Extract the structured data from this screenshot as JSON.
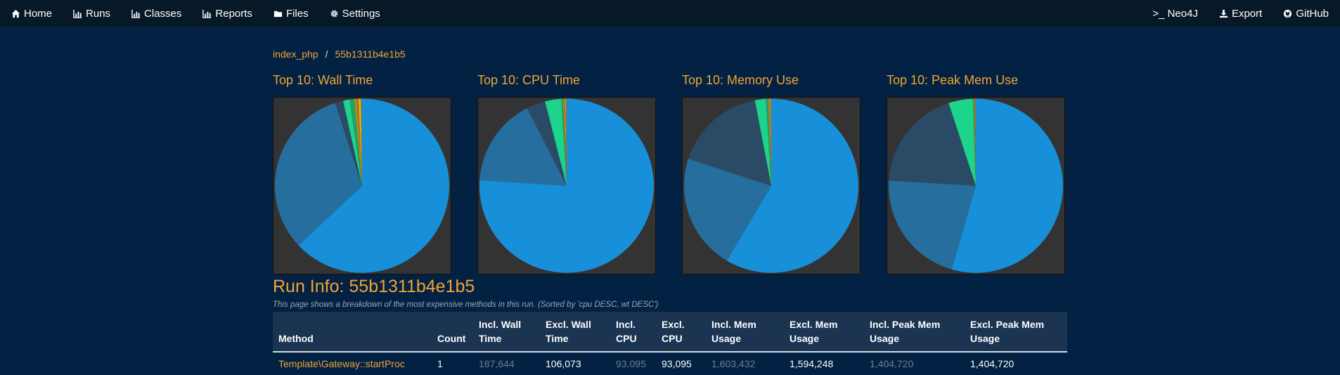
{
  "nav": {
    "left": [
      {
        "label": "Home",
        "icon": "home-icon"
      },
      {
        "label": "Runs",
        "icon": "bar-chart-icon"
      },
      {
        "label": "Classes",
        "icon": "bar-chart-icon"
      },
      {
        "label": "Reports",
        "icon": "bar-chart-icon"
      },
      {
        "label": "Files",
        "icon": "folder-icon"
      },
      {
        "label": "Settings",
        "icon": "gear-icon"
      }
    ],
    "right": [
      {
        "label": ">_ Neo4J",
        "icon": "terminal-icon"
      },
      {
        "label": "Export",
        "icon": "download-icon"
      },
      {
        "label": "GitHub",
        "icon": "github-icon"
      }
    ]
  },
  "breadcrumb": {
    "root": "index_php",
    "sep": "/",
    "current": "55b1311b4e1b5"
  },
  "charts": [
    {
      "title": "Top 10: Wall Time"
    },
    {
      "title": "Top 10: CPU Time"
    },
    {
      "title": "Top 10: Memory Use"
    },
    {
      "title": "Top 10: Peak Mem Use"
    }
  ],
  "chart_data": [
    {
      "type": "pie",
      "title": "Top 10: Wall Time",
      "values": [
        0.63,
        0.32,
        0.015,
        0.012,
        0.008,
        0.005,
        0.004,
        0.003,
        0.002,
        0.001
      ]
    },
    {
      "type": "pie",
      "title": "Top 10: CPU Time",
      "values": [
        0.76,
        0.165,
        0.035,
        0.03,
        0.003,
        0.002,
        0.002,
        0.001,
        0.001,
        0.001
      ]
    },
    {
      "type": "pie",
      "title": "Top 10: Memory Use",
      "values": [
        0.585,
        0.215,
        0.17,
        0.02,
        0.004,
        0.002,
        0.002,
        0.001,
        0.0005,
        0.0005
      ]
    },
    {
      "type": "pie",
      "title": "Top 10: Peak Mem Use",
      "values": [
        0.545,
        0.215,
        0.19,
        0.045,
        0.002,
        0.001,
        0.001,
        0.0005,
        0.0005,
        0.0005
      ]
    }
  ],
  "colors": {
    "slices": [
      "#1790d9",
      "#256e9d",
      "#2b4a66",
      "#1dd48c",
      "#21a06b",
      "#8a9a24",
      "#d0681e",
      "#e0c22a",
      "#4fbf3b",
      "#c84a2a"
    ],
    "accent": "#f0a533",
    "background": "#022143"
  },
  "run": {
    "title": "Run Info: 55b1311b4e1b5",
    "note": "This page shows a breakdown of the most expensive methods in this run. (Sorted by 'cpu DESC, wt DESC')"
  },
  "table": {
    "headers": [
      "Method",
      "Count",
      "Incl. Wall Time",
      "Excl. Wall Time",
      "Incl. CPU",
      "Excl. CPU",
      "Incl. Mem Usage",
      "Excl. Mem Usage",
      "Incl. Peak Mem Usage",
      "Excl. Peak Mem Usage"
    ],
    "rows": [
      [
        "Template\\Gateway::startProc",
        "1",
        "187,644",
        "106,073",
        "93,095",
        "93,095",
        "1,603,432",
        "1,594,248",
        "1,404,720",
        "1,404,720"
      ]
    ]
  }
}
